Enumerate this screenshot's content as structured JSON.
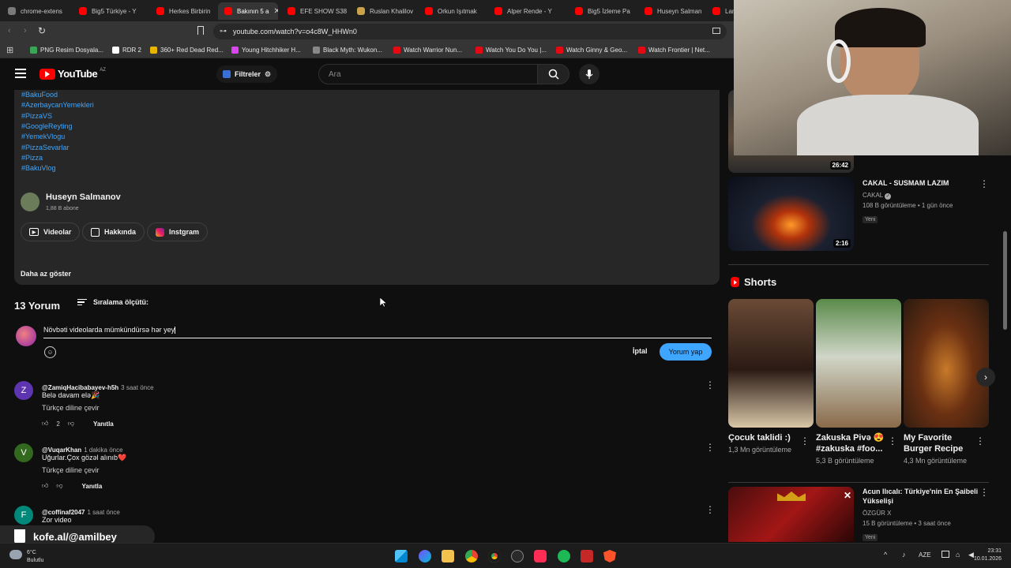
{
  "tabs": [
    {
      "label": "chrome-extens",
      "color": "#7a7a7a"
    },
    {
      "label": "Big5 Türkiye - Y",
      "color": "#ff0000"
    },
    {
      "label": "Herkes Birbirin",
      "color": "#ff0000"
    },
    {
      "label": "Bakının 5 a",
      "color": "#ff0000",
      "active": true
    },
    {
      "label": "EFE SHOW S38",
      "color": "#ff0000"
    },
    {
      "label": "Ruslan Khalilov",
      "color": "#c9a24a"
    },
    {
      "label": "Orkun Işıtmak",
      "color": "#ff0000"
    },
    {
      "label": "Alper Rende - Y",
      "color": "#ff0000"
    },
    {
      "label": "Big5 İzleme Pa",
      "color": "#ff0000"
    },
    {
      "label": "Huseyn Salman",
      "color": "#ff0000"
    },
    {
      "label": "Laman",
      "color": "#ff0000"
    }
  ],
  "address_bar": {
    "url": "youtube.com/watch?v=o4c8W_HHWn0"
  },
  "bookmarks": [
    {
      "label": "PNG Resim Dosyala...",
      "color": "#3aa655"
    },
    {
      "label": "RDR 2",
      "color": "#ffffff"
    },
    {
      "label": "360+ Red Dead Red...",
      "color": "#e8b400"
    },
    {
      "label": "Young Hitchhiker H...",
      "color": "#d946ef"
    },
    {
      "label": "Black Myth: Wukon...",
      "color": "#888888"
    },
    {
      "label": "Watch Warrior Nun...",
      "color": "#e50914"
    },
    {
      "label": "Watch You Do You |...",
      "color": "#e50914"
    },
    {
      "label": "Watch Ginny & Geo...",
      "color": "#e50914"
    },
    {
      "label": "Watch Frontier | Net...",
      "color": "#e50914"
    }
  ],
  "youtube": {
    "logo_text": "YouTube",
    "logo_country": "AZ",
    "filters_label": "Filtreler",
    "search_placeholder": "Ara"
  },
  "description": {
    "hashtags": [
      "#BakuFood",
      "#AzerbaycanYemekleri",
      "#PizzaVS",
      "#GoogleReyting",
      "#YemekVlogu",
      "#PizzaSevarlar",
      "#Pizza",
      "#BakuVlog"
    ],
    "channel_name": "Huseyn Salmanov",
    "subscribers": "1,88 B abone",
    "buttons": {
      "videos": "Videolar",
      "about": "Hakkında",
      "instagram": "Instgram"
    },
    "show_less": "Daha az göster"
  },
  "comments_section": {
    "count_label": "13 Yorum",
    "sort_label": "Sıralama ölçütü:",
    "draft_text": "Növbəti videolarda mümkündürsə hər yey",
    "cancel_label": "İptal",
    "submit_label": "Yorum yap",
    "comments": [
      {
        "author": "@ZamiqHacibabayev-h5h",
        "time": "3 saat önce",
        "text": "Belə davam elə🎉",
        "translate": "Türkçe diline çevir",
        "likes": "2",
        "reply": "Yanıtla",
        "avatar_letter": "Z",
        "avatar_color": "#5e35b1"
      },
      {
        "author": "@VuqarKhan",
        "time": "1 dakika önce",
        "text": "Uğurlar.Çox gözəl alınıb❤️",
        "translate": "Türkçe diline çevir",
        "likes": "",
        "reply": "Yanıtla",
        "avatar_letter": "V",
        "avatar_color": "#33691e"
      },
      {
        "author": "@coffinaf2047",
        "time": "1 saat önce",
        "text": "Zor video",
        "avatar_letter": "F",
        "avatar_color": "#00897b"
      }
    ]
  },
  "sidebar": {
    "videos": [
      {
        "title": "",
        "duration": "26:42"
      },
      {
        "title": "CAKAL - SUSMAM LAZIM",
        "channel": "CAKAL",
        "meta": "108 B görüntüleme • 1 gün önce",
        "badge": "Yeni",
        "duration": "2:16"
      },
      {
        "title": "Acun Ilıcalı: Türkiye'nin En Şaibeli Yükselişi",
        "channel": "ÖZGÜR X",
        "meta": "15 B görüntüleme • 3 saat önce",
        "badge": "Yeni"
      }
    ],
    "shorts_heading": "Shorts",
    "shorts": [
      {
        "title": "Çocuk taklidi :)",
        "views": "1,3 Mn görüntüleme"
      },
      {
        "title": "Zakuska Pivə 😍 #zakuska  #foo...",
        "views": "5,3 B görüntüleme"
      },
      {
        "title": "My Favorite Burger Recipe",
        "views": "4,3 Mn görüntüleme"
      }
    ]
  },
  "overlay": {
    "watermark": "kofe.al/@amilbey"
  },
  "taskbar": {
    "weather_temp": "6°C",
    "weather_desc": "Bulutlu",
    "language": "AZE",
    "time": "23:31",
    "date": "10.01.2026"
  },
  "colors": {
    "accent": "#3ea6ff",
    "youtube_red": "#ff0000"
  }
}
